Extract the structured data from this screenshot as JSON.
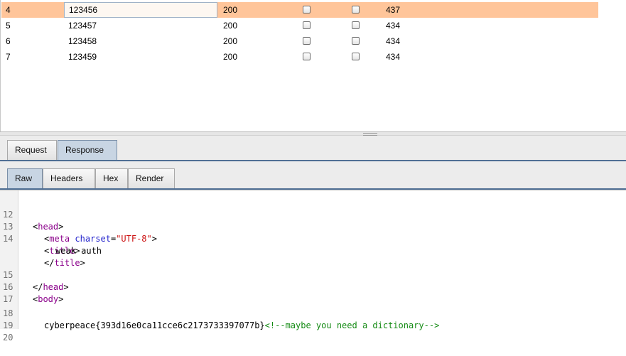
{
  "results": {
    "rows": [
      {
        "num": "4",
        "payload": "123456",
        "status": "200",
        "length": "437",
        "selected": true
      },
      {
        "num": "5",
        "payload": "123457",
        "status": "200",
        "length": "434",
        "selected": false
      },
      {
        "num": "6",
        "payload": "123458",
        "status": "200",
        "length": "434",
        "selected": false
      },
      {
        "num": "7",
        "payload": "123459",
        "status": "200",
        "length": "434",
        "selected": false
      }
    ]
  },
  "message_tabs": [
    "Request",
    "Response"
  ],
  "message_tabs_active": "Response",
  "view_tabs": [
    "Raw",
    "Headers",
    "Hex",
    "Render"
  ],
  "view_tabs_active": "Raw",
  "code": {
    "l12": {
      "num": "12",
      "open": "<",
      "tag": "head",
      "close": ">"
    },
    "l13": {
      "num": "13",
      "open": "<",
      "tag": "meta",
      "attr": "charset",
      "eq": "=",
      "val": "\"UTF-8\"",
      "close": ">"
    },
    "l14": {
      "num": "14",
      "open": "<",
      "tag": "title",
      "close": ">"
    },
    "l14b": {
      "text": "weak auth"
    },
    "l14c": {
      "open": "</",
      "tag": "title",
      "close": ">"
    },
    "l15": {
      "num": "15",
      "open": "</",
      "tag": "head",
      "close": ">"
    },
    "l16": {
      "num": "16",
      "open": "<",
      "tag": "body",
      "close": ">"
    },
    "l17": {
      "num": "17"
    },
    "l18": {
      "num": "18",
      "text": "cyberpeace{393d16e0ca11cce6c2173733397077b}",
      "comment": "<!--maybe you need a dictionary-->"
    },
    "l19": {
      "num": "19"
    },
    "l20": {
      "num": "20"
    }
  }
}
